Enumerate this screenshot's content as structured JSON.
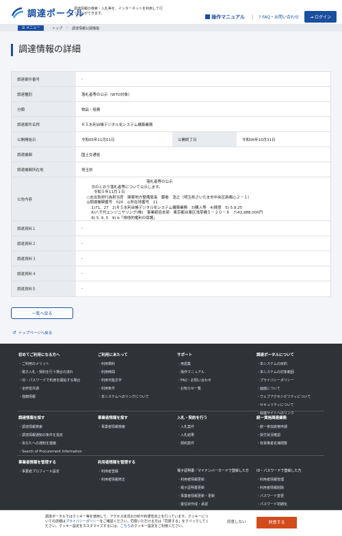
{
  "header": {
    "logo_text": "調達ポータル",
    "tagline": "調達情報の検索・入札等を、インターネットを利用して行うことができます。",
    "manual": "操作マニュアル",
    "faq": "FAQ・お問い合わせ",
    "login": "ログイン"
  },
  "breadcrumb": {
    "menu": "メニュー",
    "top": "トップ",
    "current": "調達情報公開機能"
  },
  "page_title": "調達情報の詳細",
  "details": {
    "case_no_label": "調達案件番号",
    "case_no": "-",
    "type_label": "調達種別",
    "type": "落札者等の公示（WTO対象）",
    "category_label": "分類",
    "category": "物品・役務",
    "name_label": "調達案件名称",
    "name": "Ｒ５水利台帳デジタル化システム構築業務",
    "start_label": "公開開始日",
    "start": "令和05年11月01日",
    "end_label": "公開終了日",
    "end": "令和06年10月31日",
    "org_label": "調達機関",
    "org": "国土交通省",
    "loc_label": "調達機関所在地",
    "loc": "埼玉県",
    "content_label": "公告内容",
    "content": "                                                    落札者等の公示\n      次のとおり落札者等について公示します。\n        令和５年11月１日\n  ○支出負担行為担当官　関東地方整備局長　藤巻　浩之（埼玉県さいたま市中央区新都心２－１）\n  ◎調達機関番号　020　◎所在地番号　11\n      1)71、27　2)Ｒ５水利台帳デジタル化システム構築業務　3)購入等　4)随意　5) 5.9.25\n      6)八千代エンジニヤリング(株)　事業統括本部　東京都台東区浅草橋５－２０－８　7)42,988,000円\n      8) 5. 9. 5　9) b「排他的権利の保護」",
    "doc1_label": "調達資料１",
    "doc1": "-",
    "doc2_label": "調達資料２",
    "doc2": "-",
    "doc3_label": "調達資料３",
    "doc3": "-",
    "doc4_label": "調達資料４",
    "doc4": "-",
    "doc5_label": "調達資料５",
    "doc5": "-"
  },
  "back_button": "一覧へ戻る",
  "top_link": "トップページへ戻る",
  "footer": {
    "col1_title": "初めてご利用になる方へ",
    "col1": [
      "ご利用のメリット",
      "電子入札・契約を行う場合の流れ",
      "ID・パスワードで利用を開始する場合",
      "全府省共通",
      "強靭情報"
    ],
    "col2_title": "ご利用にあたって",
    "col2": [
      "利用規約",
      "利用時間",
      "利用可能文字",
      "利用条件",
      "本システムへのリンクについて"
    ],
    "col3_title": "サポート",
    "col3": [
      "用語集",
      "操作マニュアル",
      "FAQ・お問い合わせ",
      "お知らせ一覧"
    ],
    "col4_title": "調達ポータルについて",
    "col4": [
      "本システムの目的",
      "本システムの対象範囲",
      "プライバシーポリシー",
      "画面について",
      "ウェブアクセシビリティについて",
      "セキュリティについて",
      "関連サイトへのリンク"
    ],
    "r2c1_title": "調達情報を探す",
    "r2c1": [
      "調達情報検索",
      "調達情報通知の条件を指定",
      "あなたへの通知を連絡",
      "Search of Procurement Information"
    ],
    "r2c2_title": "事業者情報を探す",
    "r2c2": [
      "事業者情報検索"
    ],
    "r2c3_title": "入札・契約を行う",
    "r2c3": [
      "入札案件",
      "入札結果",
      "契約案件"
    ],
    "r2c4_title": "統一資格関連業務",
    "r2c4": [
      "統一参加資格申請",
      "受付状況確認",
      "有資格者名簿閲覧"
    ],
    "r3c1_title": "事業者情報を管理する",
    "r3c1": [
      "事業者プロフィール設定"
    ],
    "r3c2_title": "利用者情報を管理する",
    "r3c2": [
      "利用者登録",
      "利用者情報修正"
    ],
    "r3c3_title": "電子証明書／マイナンバーカードで登録した方",
    "r3c3": [
      "利用者情報更新",
      "電子証明書更新",
      "事業者情報更新・更新",
      "委任状作成・承認"
    ],
    "r3c4_title": "ID・パスワードで登録した方",
    "r3c4": [
      "利用者情報管理",
      "利用者情報削除",
      "パスワード変更",
      "パスワード初期化"
    ]
  },
  "cookie": {
    "text1": "調達ポータルではクッキー等を使用して、アクセス状況の分析や利便性向上を行っています。クッキーについての詳細は",
    "privacy": "プライバシーポリシー",
    "text2": "をご確認ください。同意いただける方は「同意する」をクリックしてください。クッキー設定をカスタマイズするには、",
    "here": "こちら",
    "text3": "のクッキー設定をご利用ください。",
    "refuse": "同意しない",
    "accept": "同意する"
  },
  "colors": {
    "brand": "#1a4fa0",
    "accept": "#d24b1a"
  }
}
